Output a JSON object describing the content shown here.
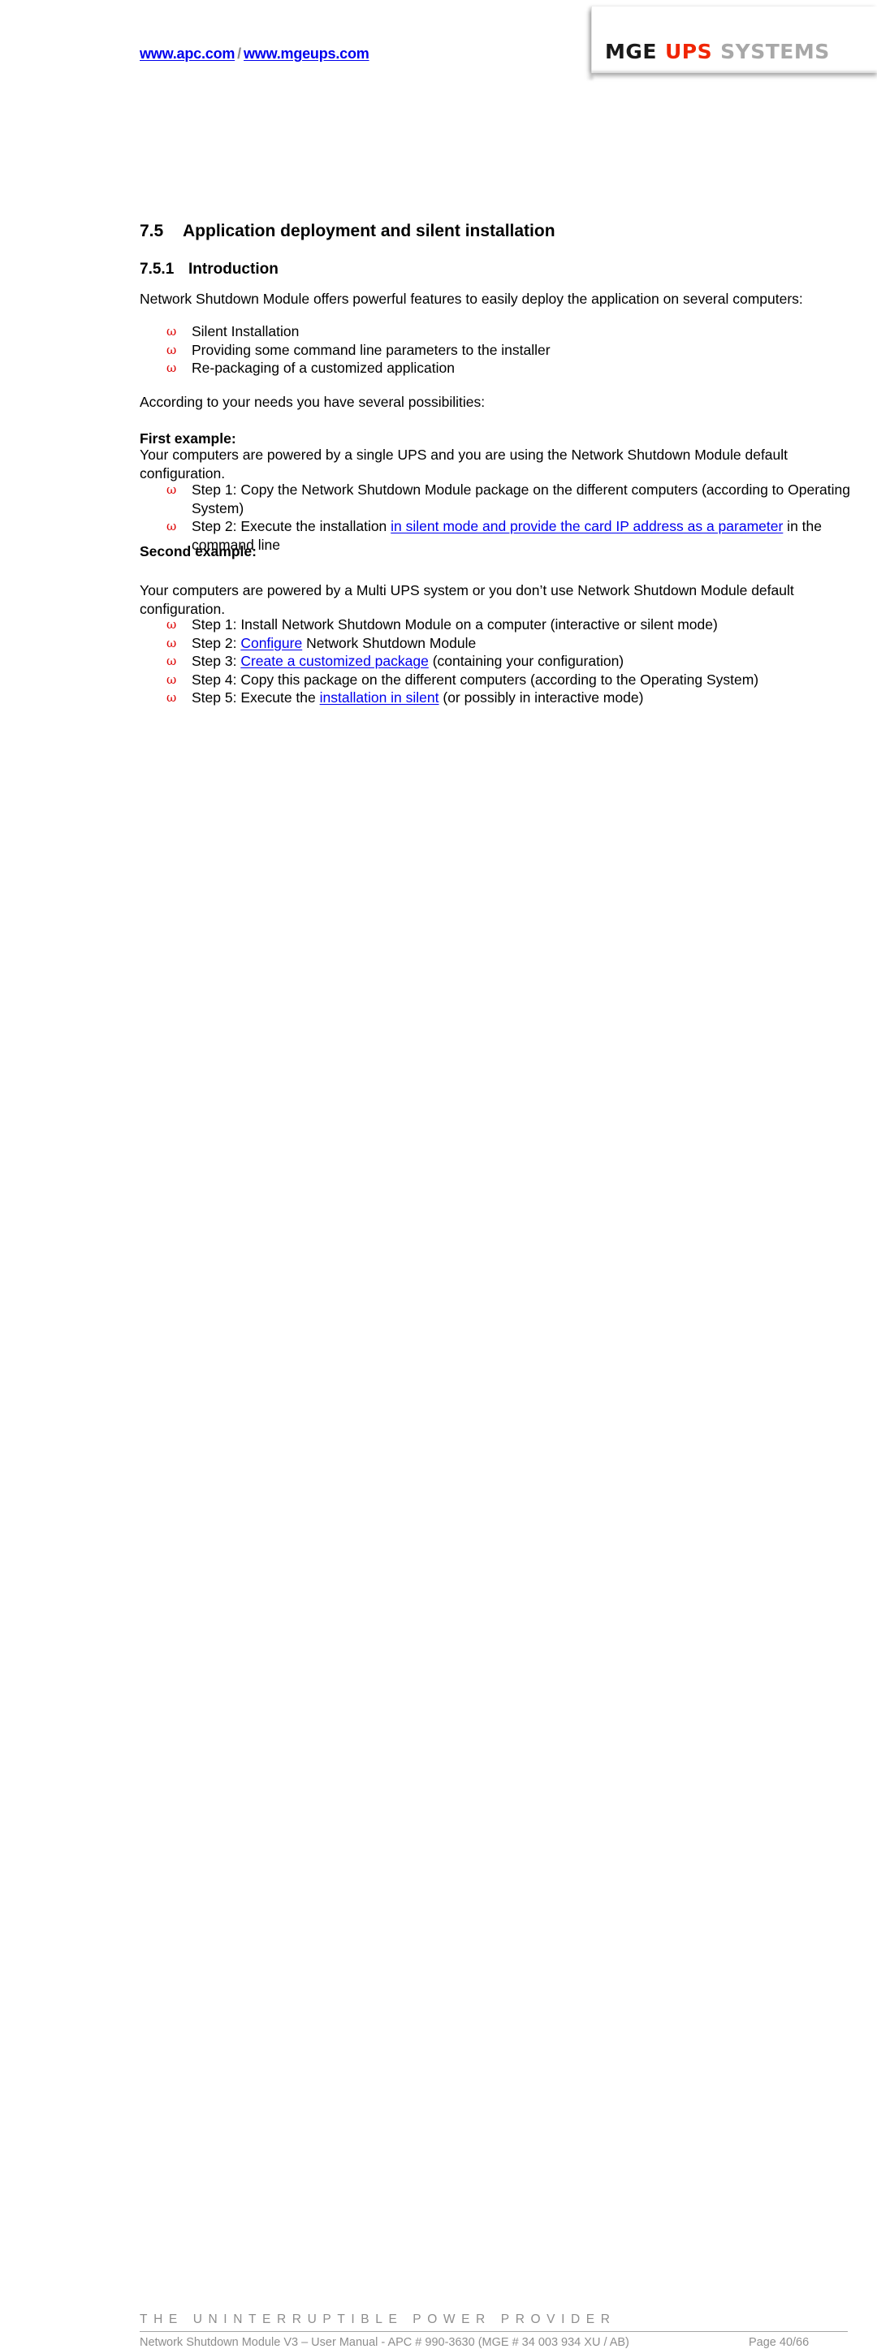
{
  "header": {
    "url_primary": "www.apc.com",
    "url_separator": "/",
    "url_secondary": "www.mgeups.com",
    "link_color": "#0000ee",
    "logo": {
      "part1": "MGE",
      "part2": "UPS",
      "part3": "SYSTEMS",
      "part1_color": "#1a1a1a",
      "part2_color": "#f02505",
      "part3_color": "#a8a8a8"
    }
  },
  "section": {
    "number": "7.5",
    "title": "Application deployment and silent installation",
    "sub_number": "7.5.1",
    "sub_title": "Introduction",
    "lead_paragraph": "Network Shutdown Module offers powerful features to easily deploy the application on several computers:",
    "features": [
      "Silent Installation",
      "Providing some command line parameters to the installer",
      "Re-packaging of a customized application"
    ],
    "according_paragraph": "According to your needs you have several possibilities:",
    "bullet_glyph": "ω",
    "bullet_color": "#dd0000"
  },
  "first_example": {
    "heading": "First example:",
    "body": "Your computers are powered by a single UPS and you are using the Network Shutdown Module default configuration.",
    "steps": [
      {
        "pre": "Step 1: Copy the Network Shutdown Module package on the different computers (according to Operating System)",
        "link": "",
        "post": ""
      },
      {
        "pre": "Step 2: Execute the installation ",
        "link": "in silent mode and provide the card IP address as a parameter",
        "post": " in the command line"
      }
    ]
  },
  "second_example": {
    "heading": "Second example:",
    "body": "Your computers are powered by a Multi UPS system or you don’t use Network Shutdown Module default configuration.",
    "steps": [
      {
        "pre": "Step 1: Install Network Shutdown Module on a computer (interactive or silent mode)",
        "link": "",
        "post": ""
      },
      {
        "pre": "Step 2: ",
        "link": "Configure",
        "post": " Network Shutdown Module"
      },
      {
        "pre": "Step 3: ",
        "link": "Create a customized package",
        "post": " (containing your configuration)"
      },
      {
        "pre": "Step 4: Copy this package on the different computers (according to the Operating System)",
        "link": "",
        "post": ""
      },
      {
        "pre": "Step 5: Execute the ",
        "link": "installation in silent",
        "post": " (or possibly in interactive mode)"
      }
    ]
  },
  "footer": {
    "tagline": "THE UNINTERRUPTIBLE POWER PROVIDER",
    "document_line": "Network Shutdown Module V3 – User Manual - APC # 990-3630 (MGE # 34 003 934 XU / AB)",
    "page_label": "Page 40/66",
    "text_color": "#8e8e8e"
  }
}
